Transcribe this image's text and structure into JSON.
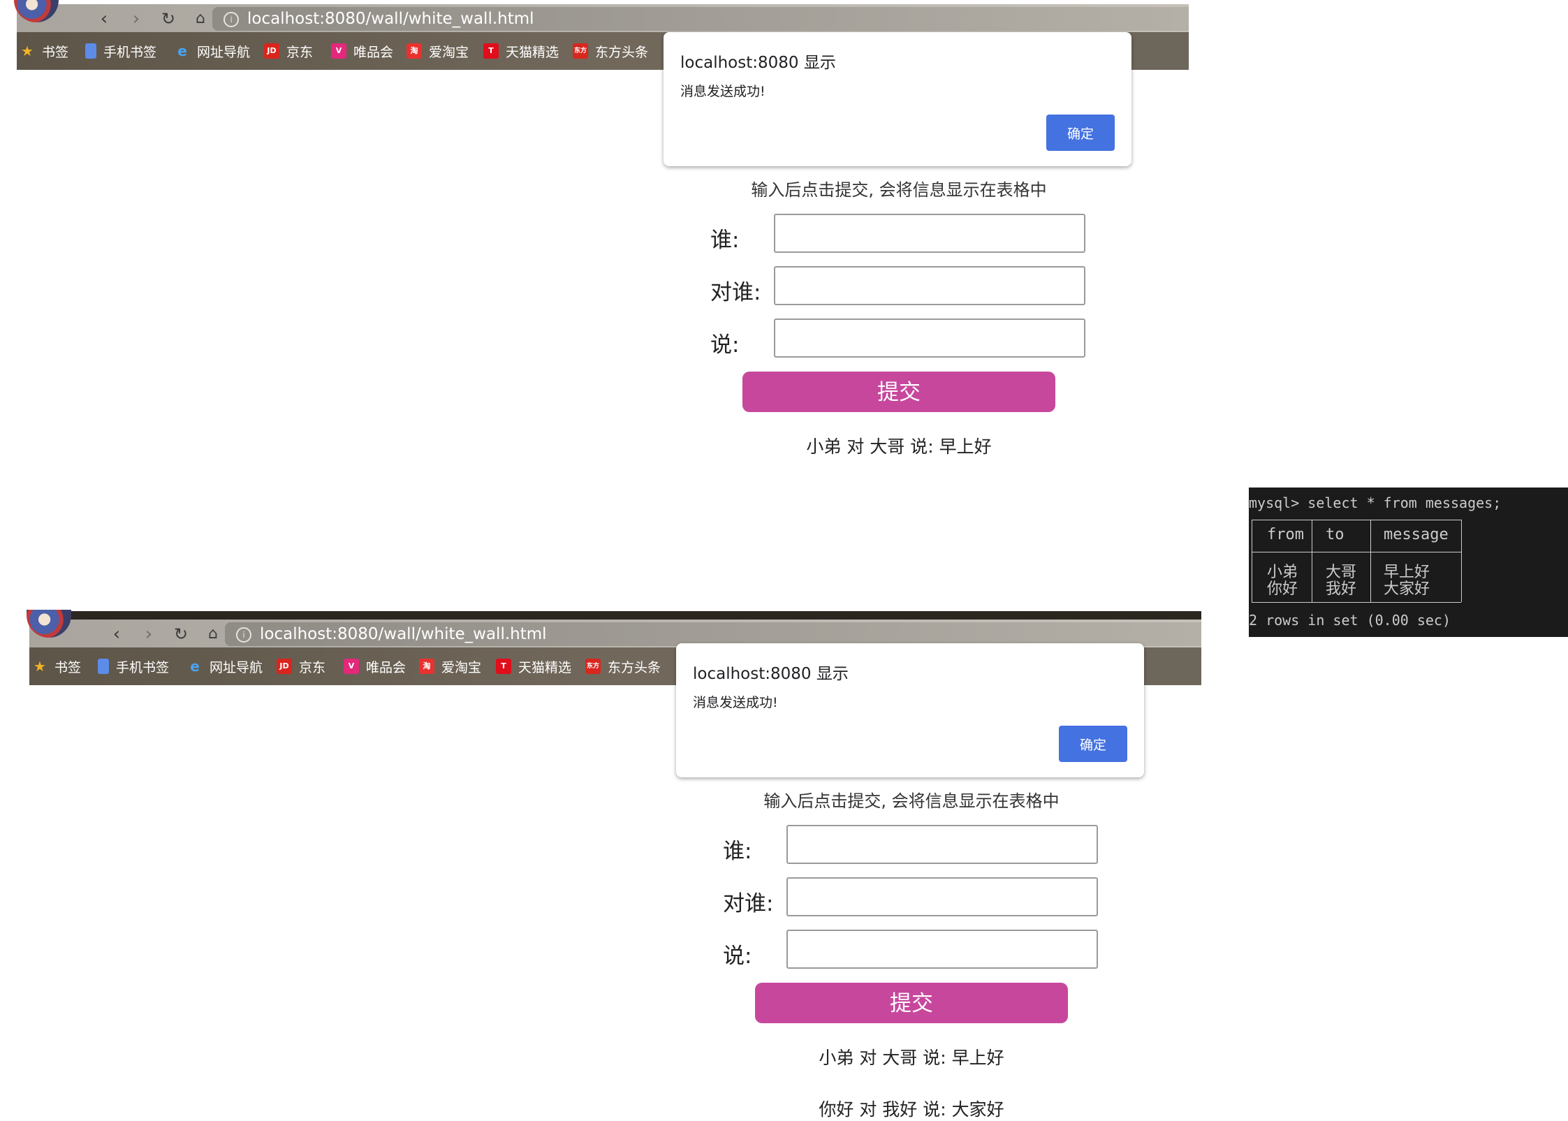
{
  "screenshot_top": {
    "browser": {
      "url": "localhost:8080/wall/white_wall.html",
      "bookmarks": [
        "书签",
        "手机书签",
        "网址导航",
        "京东",
        "唯品会",
        "爱淘宝",
        "天猫精选",
        "东方头条"
      ]
    },
    "alert": {
      "title": "localhost:8080 显示",
      "message": "消息发送成功!",
      "ok_label": "确定"
    },
    "form": {
      "hint": "输入后点击提交, 会将信息显示在表格中",
      "who_label": "谁:",
      "to_label": "对谁:",
      "say_label": "说:",
      "submit_label": "提交"
    },
    "messages": [
      "小弟 对 大哥 说: 早上好"
    ]
  },
  "screenshot_bottom": {
    "browser": {
      "url": "localhost:8080/wall/white_wall.html",
      "bookmarks": [
        "书签",
        "手机书签",
        "网址导航",
        "京东",
        "唯品会",
        "爱淘宝",
        "天猫精选",
        "东方头条"
      ]
    },
    "alert": {
      "title": "localhost:8080 显示",
      "message": "消息发送成功!",
      "ok_label": "确定"
    },
    "form": {
      "hint": "输入后点击提交, 会将信息显示在表格中",
      "who_label": "谁:",
      "to_label": "对谁:",
      "say_label": "说:",
      "submit_label": "提交"
    },
    "messages": [
      "小弟 对 大哥 说: 早上好",
      "你好 对 我好 说: 大家好"
    ]
  },
  "terminal": {
    "command": "mysql> select * from messages;",
    "columns": [
      "from",
      "to",
      "message"
    ],
    "rows": [
      [
        "小弟",
        "大哥",
        "早上好"
      ],
      [
        "你好",
        "我好",
        "大家好"
      ]
    ],
    "result": "2 rows in set (0.00 sec)"
  },
  "colors": {
    "submit": "#c7479d",
    "dialog_button": "#4472e0",
    "terminal_bg": "#1b1b1b"
  },
  "icons": {
    "bookmarks": [
      "star-icon",
      "phone-bookmark-icon",
      "ie-icon",
      "jd-icon",
      "vip-icon",
      "taobao-icon",
      "tmall-icon",
      "dongfang-icon"
    ]
  }
}
